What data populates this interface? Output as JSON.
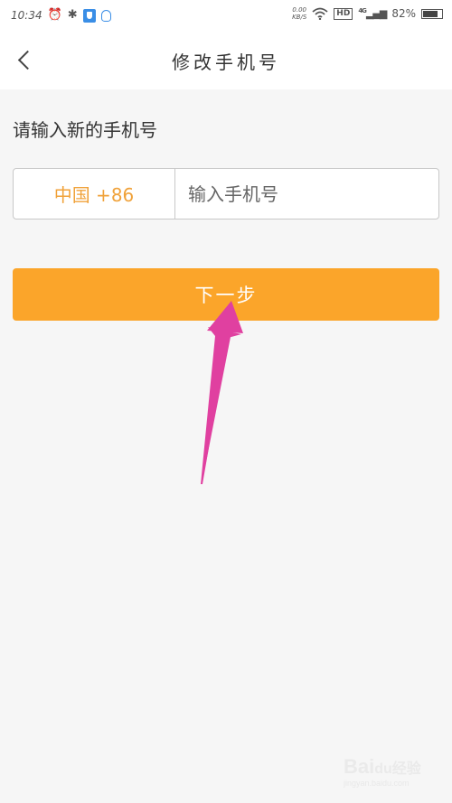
{
  "status_bar": {
    "time": "10:34",
    "net_speed_value": "0.00",
    "net_speed_unit": "KB/S",
    "hd_label": "HD",
    "network_type": "4G",
    "battery_percent": "82%",
    "battery_level": 0.82,
    "icons": [
      "alarm-icon",
      "bluetooth-icon",
      "shield-app-icon",
      "qq-icon",
      "wifi-icon",
      "signal-icon",
      "battery-icon"
    ]
  },
  "nav": {
    "title": "修改手机号",
    "back_icon": "chevron-left-icon"
  },
  "form": {
    "prompt": "请输入新的手机号",
    "country_code": "中国 +86",
    "phone_value": "",
    "phone_placeholder": "输入手机号",
    "next_button": "下一步"
  },
  "annotation": {
    "arrow_color": "#e040a0",
    "points_to": "next-button"
  },
  "watermark": {
    "brand": "Bai",
    "brand_suffix": "du经验",
    "site": "jingyan.baidu.com"
  },
  "colors": {
    "accent": "#fba52a",
    "country_code_text": "#f0a23a",
    "background": "#f6f6f6"
  }
}
